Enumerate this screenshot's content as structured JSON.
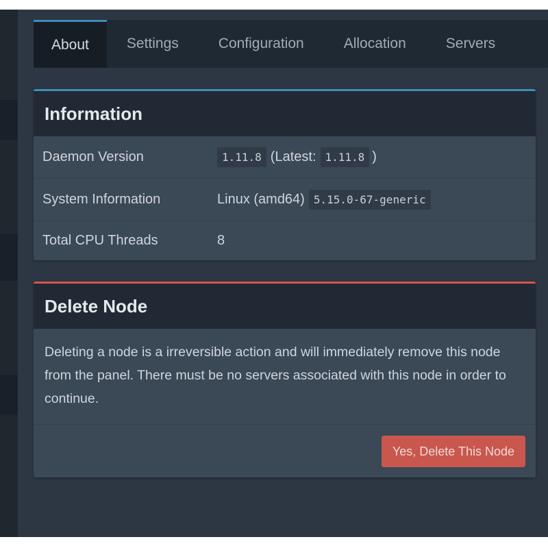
{
  "tabs": [
    {
      "label": "About",
      "active": true
    },
    {
      "label": "Settings",
      "active": false
    },
    {
      "label": "Configuration",
      "active": false
    },
    {
      "label": "Allocation",
      "active": false
    },
    {
      "label": "Servers",
      "active": false
    }
  ],
  "information": {
    "title": "Information",
    "daemon_version": {
      "label": "Daemon Version",
      "version": "1.11.8",
      "latest_prefix": "(Latest:",
      "latest_version": "1.11.8",
      "latest_suffix": ")"
    },
    "system_information": {
      "label": "System Information",
      "os": "Linux (amd64)",
      "kernel": "5.15.0-67-generic"
    },
    "cpu_threads": {
      "label": "Total CPU Threads",
      "value": "8"
    }
  },
  "delete_node": {
    "title": "Delete Node",
    "description": "Deleting a node is a irreversible action and will immediately remove this node from the panel. There must be no servers associated with this node in order to continue.",
    "button_label": "Yes, Delete This Node"
  },
  "colors": {
    "info_accent": "#3c8dbc",
    "danger_accent": "#d9534f"
  }
}
